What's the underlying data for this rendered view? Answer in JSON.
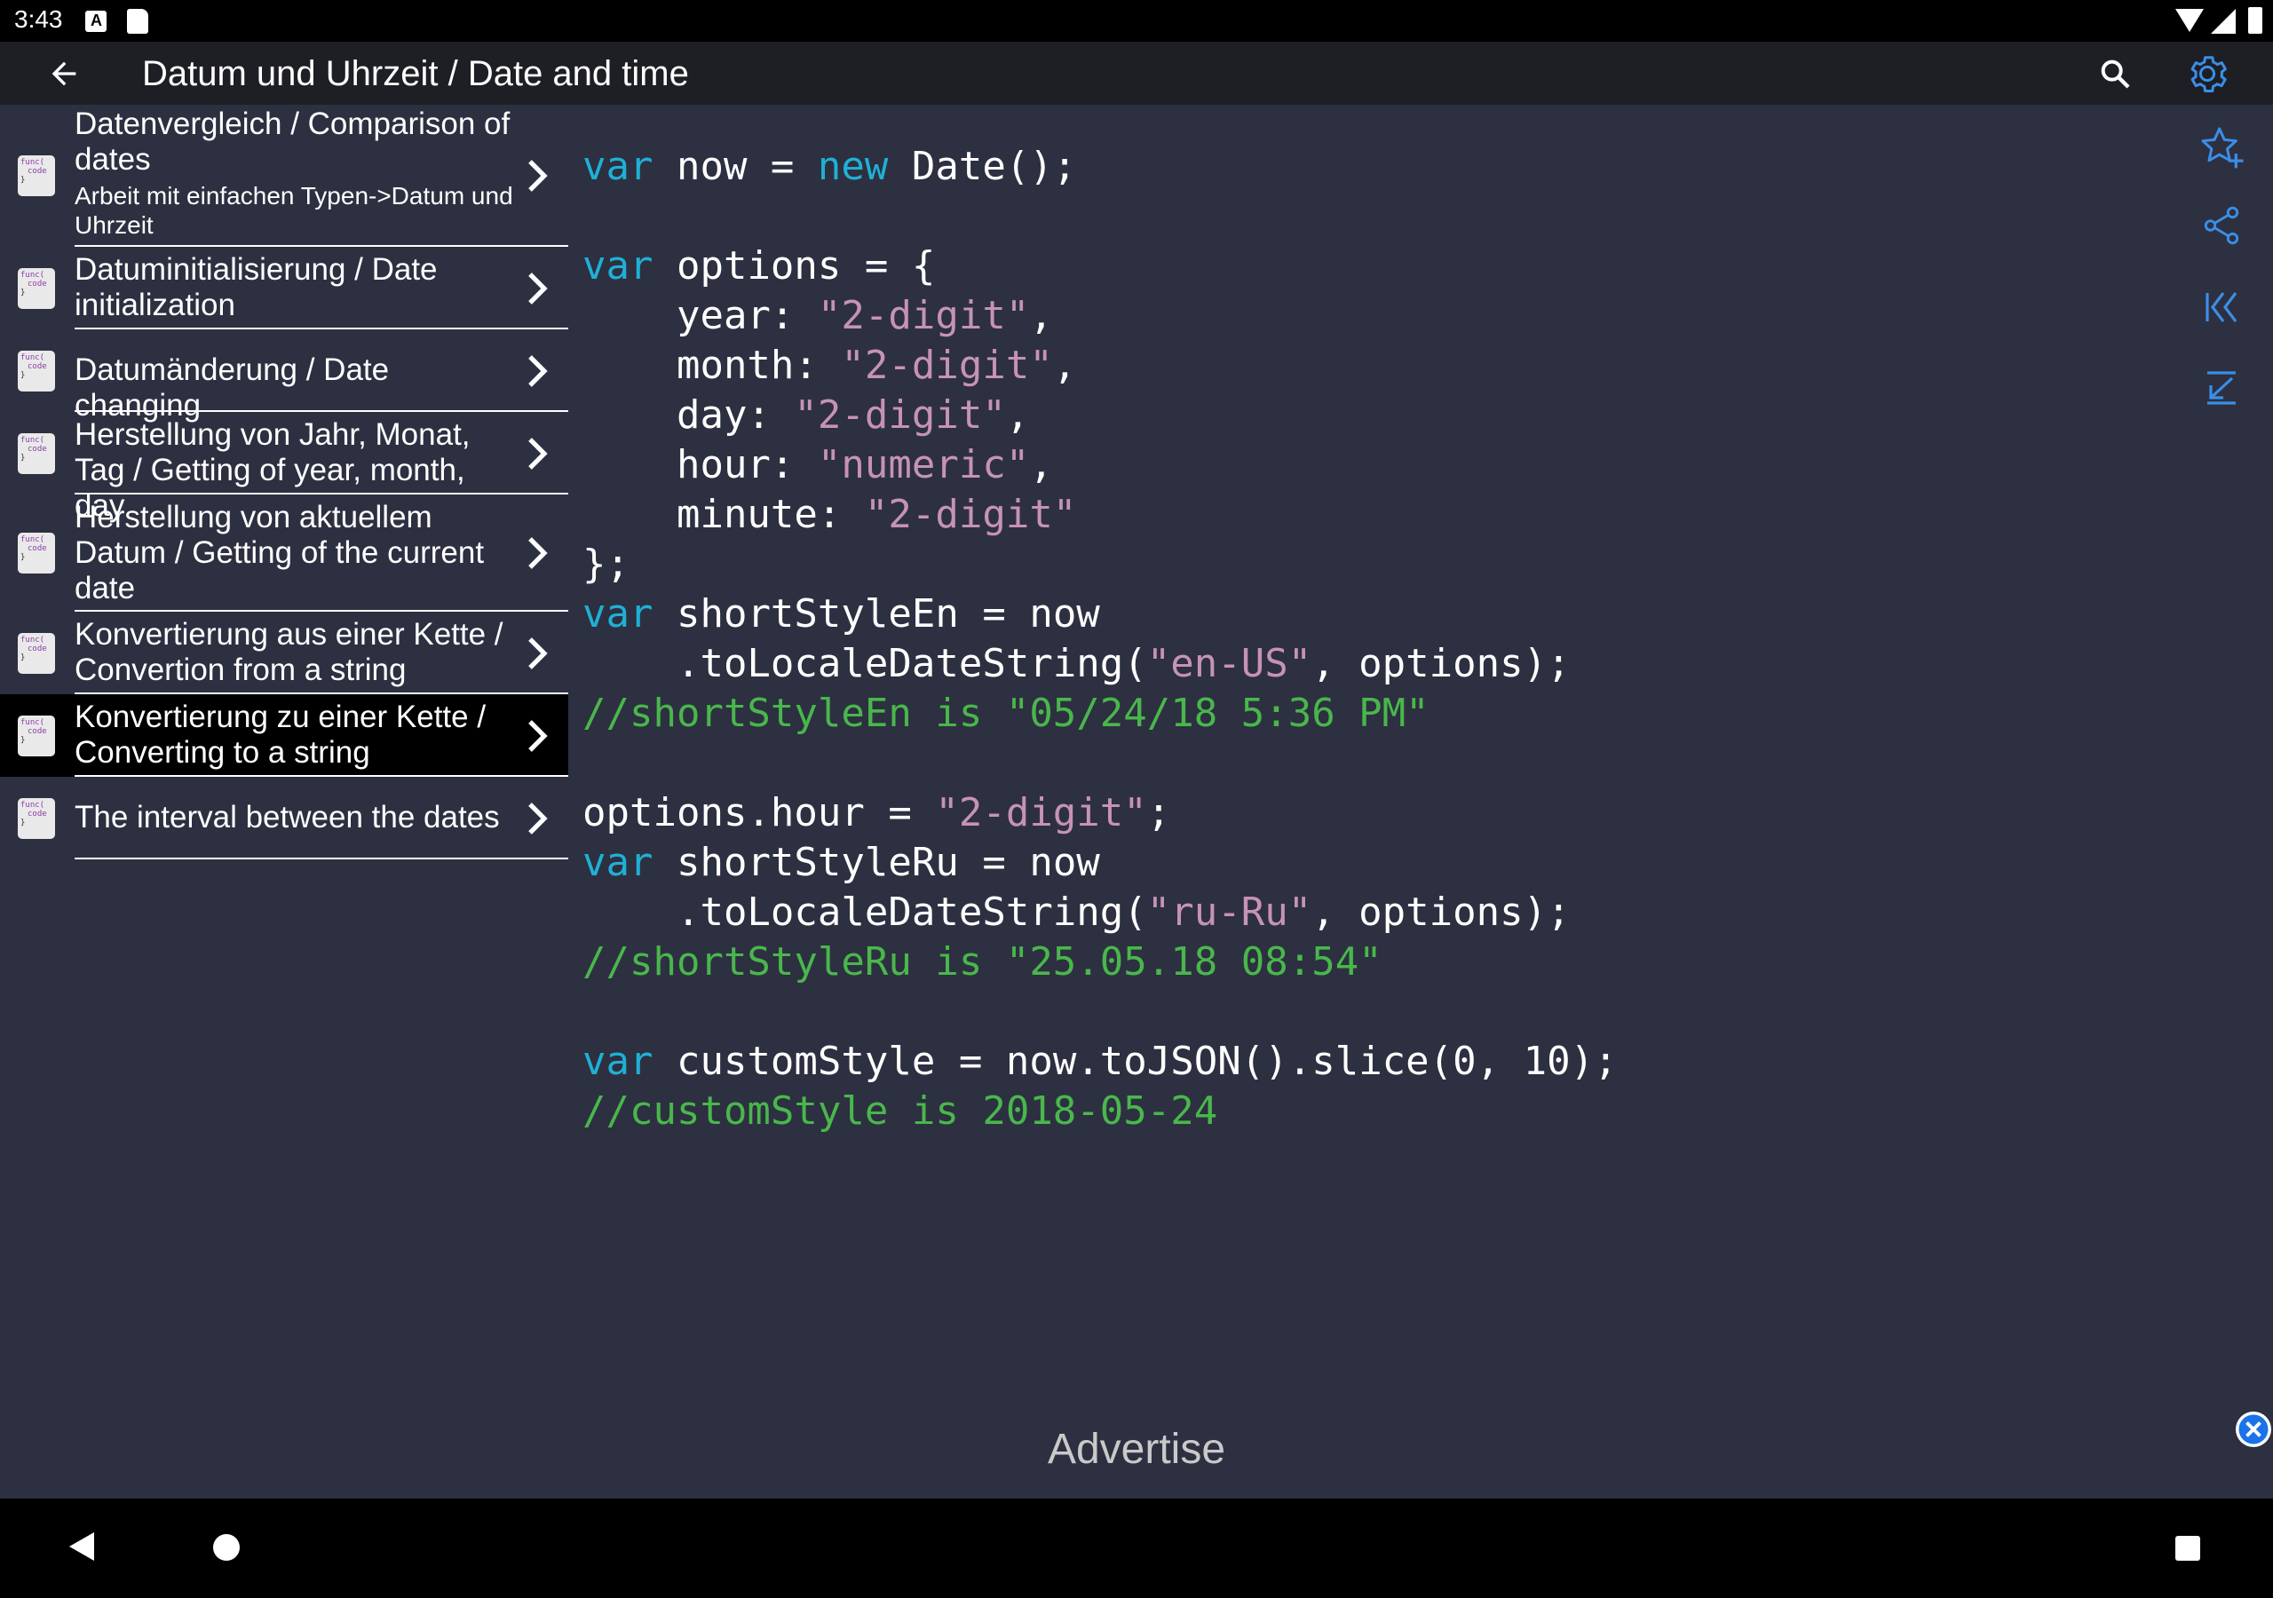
{
  "status_bar": {
    "time": "3:43"
  },
  "app_bar": {
    "title": "Datum und Uhrzeit / Date and time"
  },
  "sidebar": {
    "items": [
      {
        "title": "Datenvergleich / Comparison of dates",
        "subtitle": "Arbeit mit einfachen Typen->Datum und Uhrzeit"
      },
      {
        "title": "Datuminitialisierung / Date initialization"
      },
      {
        "title": "Datumänderung / Date changing"
      },
      {
        "title": "Herstellung von Jahr, Monat, Tag / Getting of year, month, day"
      },
      {
        "title": "Herstellung von aktuellem Datum / Getting of the current date"
      },
      {
        "title": "Konvertierung aus einer Kette / Convertion from a string"
      },
      {
        "title": "Konvertierung zu einer Kette / Converting to a string",
        "selected": true
      },
      {
        "title": "The interval between the dates"
      }
    ],
    "icon_text": [
      "func(",
      "code",
      "}"
    ]
  },
  "code": {
    "lines": [
      [
        {
          "t": "var",
          "c": "kw"
        },
        {
          "t": " now = "
        },
        {
          "t": "new",
          "c": "kw"
        },
        {
          "t": " Date();"
        }
      ],
      [],
      [
        {
          "t": "var",
          "c": "kw"
        },
        {
          "t": " options = {"
        }
      ],
      [
        {
          "t": "    year: "
        },
        {
          "t": "\"2-digit\"",
          "c": "str"
        },
        {
          "t": ","
        }
      ],
      [
        {
          "t": "    month: "
        },
        {
          "t": "\"2-digit\"",
          "c": "str"
        },
        {
          "t": ","
        }
      ],
      [
        {
          "t": "    day: "
        },
        {
          "t": "\"2-digit\"",
          "c": "str"
        },
        {
          "t": ","
        }
      ],
      [
        {
          "t": "    hour: "
        },
        {
          "t": "\"numeric\"",
          "c": "str"
        },
        {
          "t": ","
        }
      ],
      [
        {
          "t": "    minute: "
        },
        {
          "t": "\"2-digit\"",
          "c": "str"
        }
      ],
      [
        {
          "t": "};"
        }
      ],
      [
        {
          "t": "var",
          "c": "kw"
        },
        {
          "t": " shortStyleEn = now"
        }
      ],
      [
        {
          "t": "    .toLocaleDateString("
        },
        {
          "t": "\"en-US\"",
          "c": "str"
        },
        {
          "t": ", options);"
        }
      ],
      [
        {
          "t": "//shortStyleEn is \"05/24/18 5:36 PM\"",
          "c": "cm"
        }
      ],
      [],
      [
        {
          "t": "options.hour = "
        },
        {
          "t": "\"2-digit\"",
          "c": "str"
        },
        {
          "t": ";"
        }
      ],
      [
        {
          "t": "var",
          "c": "kw"
        },
        {
          "t": " shortStyleRu = now"
        }
      ],
      [
        {
          "t": "    .toLocaleDateString("
        },
        {
          "t": "\"ru-Ru\"",
          "c": "str"
        },
        {
          "t": ", options);"
        }
      ],
      [
        {
          "t": "//shortStyleRu is \"25.05.18 08:54\"",
          "c": "cm"
        }
      ],
      [],
      [
        {
          "t": "var",
          "c": "kw"
        },
        {
          "t": " customStyle = now.toJSON().slice(0, 10);"
        }
      ],
      [
        {
          "t": "//customStyle is 2018-05-24",
          "c": "cm"
        }
      ]
    ]
  },
  "ad": {
    "label": "Advertise"
  },
  "colors": {
    "background": "#2d3040",
    "app_bar": "#1e1f24",
    "accent": "#3b8ee8",
    "keyword": "#1fb0d6",
    "string": "#c693b4",
    "comment": "#49b74c"
  },
  "icons": {
    "app_bar": [
      "arrow-left-icon",
      "search-icon",
      "gear-icon"
    ],
    "right_toolbar": [
      "star-plus-icon",
      "share-icon",
      "skip-to-start-icon",
      "arrow-down-to-line-icon"
    ],
    "nav": [
      "nav-back-icon",
      "nav-home-icon",
      "nav-recents-icon"
    ]
  }
}
